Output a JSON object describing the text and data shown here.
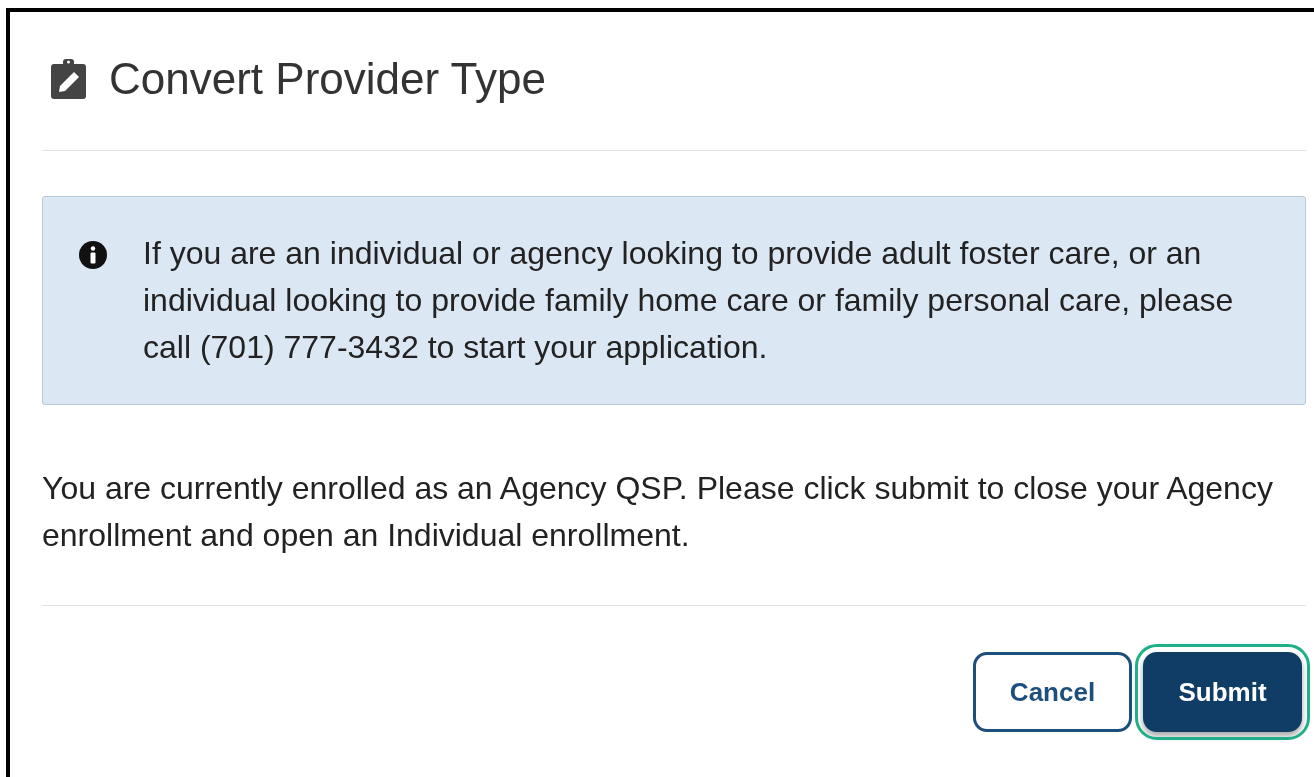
{
  "dialog": {
    "title": "Convert Provider Type",
    "alert": "If you are an individual or agency looking to provide adult foster care, or an individual looking to provide family home care or family personal care, please call (701) 777-3432 to start your application.",
    "message": "You are currently enrolled as an Agency QSP. Please click submit to close your Agency enrollment and open an Individual enrollment.",
    "buttons": [
      {
        "label": "Cancel",
        "kind": "secondary",
        "highlighted": false
      },
      {
        "label": "Submit",
        "kind": "primary",
        "highlighted": true
      }
    ]
  }
}
